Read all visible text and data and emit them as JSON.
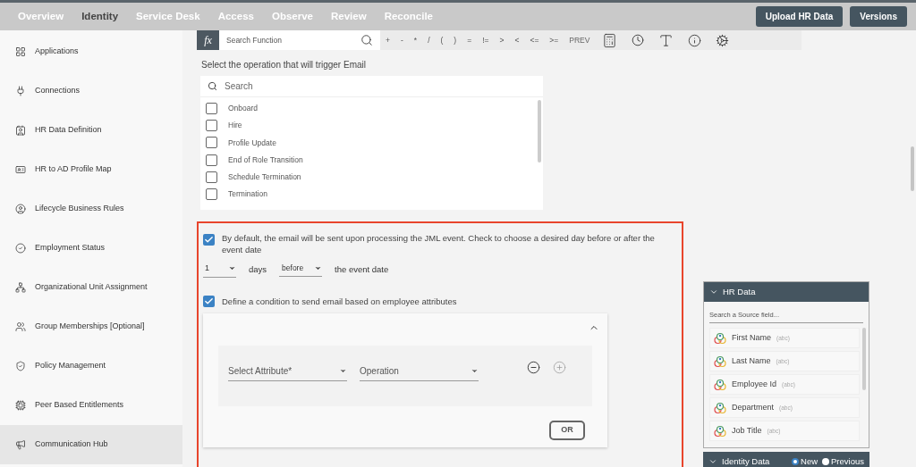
{
  "nav": {
    "tabs": [
      {
        "label": "Overview",
        "selected": false
      },
      {
        "label": "Identity",
        "selected": true
      },
      {
        "label": "Service Desk",
        "selected": false
      },
      {
        "label": "Access",
        "selected": false
      },
      {
        "label": "Observe",
        "selected": false
      },
      {
        "label": "Review",
        "selected": false
      },
      {
        "label": "Reconcile",
        "selected": false
      }
    ],
    "buttons": [
      "Upload HR Data",
      "Versions"
    ]
  },
  "sidebar": {
    "items": [
      {
        "label": "Applications",
        "kind": "grid",
        "selected": false
      },
      {
        "label": "Connections",
        "kind": "plug",
        "selected": false
      },
      {
        "label": "HR Data Definition",
        "kind": "contact",
        "selected": false
      },
      {
        "label": "HR to AD Profile Map",
        "kind": "card",
        "selected": false
      },
      {
        "label": "Lifecycle Business Rules",
        "kind": "user",
        "selected": false
      },
      {
        "label": "Employment Status",
        "kind": "check",
        "selected": false
      },
      {
        "label": "Organizational Unit Assignment",
        "kind": "network",
        "selected": false
      },
      {
        "label": "Group Memberships [Optional]",
        "kind": "users",
        "selected": false
      },
      {
        "label": "Policy Management",
        "kind": "shield",
        "selected": false
      },
      {
        "label": "Peer Based Entitlements",
        "kind": "chip",
        "selected": false
      },
      {
        "label": "Communication Hub",
        "kind": "megaphone",
        "selected": true
      }
    ]
  },
  "formula_bar": {
    "fx": "fx",
    "search_placeholder": "Search Function",
    "operators": [
      "+",
      "-",
      "*",
      "/",
      "(",
      ")",
      "=",
      "!=",
      ">",
      "<",
      "<=",
      ">="
    ],
    "prev": "PREV"
  },
  "trigger": {
    "prompt": "Select the operation that will trigger Email",
    "search_placeholder": "Search",
    "operations": [
      {
        "label": "Onboard",
        "checked": false
      },
      {
        "label": "Hire",
        "checked": false
      },
      {
        "label": "Profile Update",
        "checked": false
      },
      {
        "label": "End of Role Transition",
        "checked": false
      },
      {
        "label": "Schedule Termination",
        "checked": false
      },
      {
        "label": "Termination",
        "checked": false
      }
    ]
  },
  "schedule": {
    "checked": true,
    "text": "By default, the email will be sent upon processing the JML event. Check to choose a desired day before or after the event date",
    "days_value": "1",
    "days_label": "days",
    "direction_value": "before",
    "suffix": "the event date"
  },
  "condition": {
    "checked": true,
    "text": "Define a condition to send email based on employee attributes",
    "expanded": true,
    "attribute_placeholder": "Select Attribute*",
    "operation_placeholder": "Operation",
    "or_button": "OR"
  },
  "hr_data": {
    "title": "HR Data",
    "expanded": true,
    "search_placeholder": "Search a Source field...",
    "fields": [
      {
        "name": "First Name",
        "type": "(abc)"
      },
      {
        "name": "Last Name",
        "type": "(abc)"
      },
      {
        "name": "Employee Id",
        "type": "(abc)"
      },
      {
        "name": "Department",
        "type": "(abc)"
      },
      {
        "name": "Job Title",
        "type": "(abc)"
      }
    ]
  },
  "identity_data": {
    "title": "Identity Data",
    "options": [
      {
        "label": "New",
        "selected": true
      },
      {
        "label": "Previous",
        "selected": false
      }
    ]
  }
}
